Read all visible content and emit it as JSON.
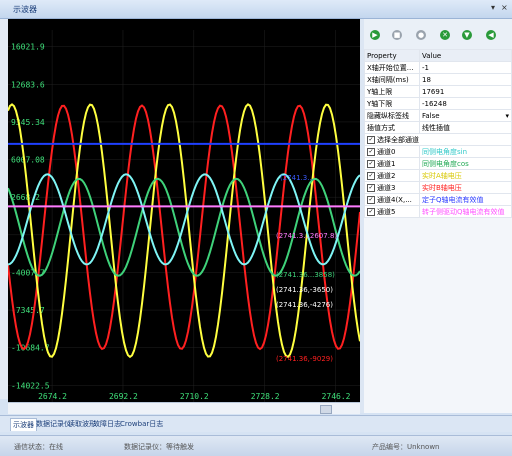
{
  "window": {
    "title": "示波器",
    "pin": "▾",
    "close": "×"
  },
  "toolbar": {
    "icons": [
      "play-icon",
      "stop-icon",
      "record-icon",
      "close-icon",
      "download-icon",
      "back-icon"
    ]
  },
  "chart_data": {
    "type": "line",
    "xlim": [
      2663.0,
      2752.4
    ],
    "ylim": [
      -15500,
      17500
    ],
    "yticks": [
      "16021.9",
      "12683.6",
      "9345.34",
      "6007.08",
      "2668.82",
      "-669.443",
      "-4007.7",
      "-7345.97",
      "-10684.2",
      "-14022.5"
    ],
    "ytick_values": [
      16021.9,
      12683.6,
      9345.34,
      6007.08,
      2668.82,
      -669.443,
      -4007.7,
      -7345.97,
      -10684.2,
      -14022.5
    ],
    "ytick_label_text": [
      "16021.9",
      "12683.6",
      "9345.34",
      "6007.08",
      "2668.2",
      "",
      "-4007.7",
      "-7345.7",
      "-10684.7",
      "-14022.5"
    ],
    "xticks": [
      "2674.2",
      "2692.2",
      "2710.2",
      "2728.2",
      "2746.2"
    ],
    "xtick_values": [
      2674.2,
      2692.2,
      2710.2,
      2728.2,
      2746.2
    ],
    "series": [
      {
        "color": "#ff2020",
        "kind": "sine",
        "amplitude": 10800,
        "offset": 0,
        "period": 20,
        "phase": 0.55
      },
      {
        "color": "#ffff40",
        "kind": "sine",
        "amplitude": 11200,
        "offset": -300,
        "period": 20,
        "phase": 0.2
      },
      {
        "color": "#3fd27a",
        "kind": "sine",
        "amplitude": 4300,
        "offset": 0,
        "period": 20,
        "phase": 0.35
      },
      {
        "color": "#7ff5f5",
        "kind": "sine",
        "amplitude": 4000,
        "offset": 700,
        "period": 20,
        "phase": 0.75
      },
      {
        "color": "#1f40ff",
        "kind": "hline",
        "value": 7400
      },
      {
        "color": "#ff7bff",
        "kind": "hline",
        "value": 1850
      }
    ],
    "annotations": [
      {
        "text": "(2741.3...",
        "color": "#3a5bff"
      },
      {
        "text": "(2741.3...2607.8)",
        "color": "#ff7bff"
      },
      {
        "text": "(2741.36...3858)",
        "color": "#3fd27a"
      },
      {
        "text": "(2741.36,-3650)",
        "color": "#ffffff"
      },
      {
        "text": "(2741.36,-4276)",
        "color": "#ffffff"
      },
      {
        "text": "(2741.36,-9029)",
        "color": "#ff2020"
      }
    ]
  },
  "properties": {
    "header": {
      "name": "Property",
      "value": "Value"
    },
    "rows": [
      {
        "name": "X轴开始位置...",
        "value": "-1"
      },
      {
        "name": "X轴间隔(ms)",
        "value": "18"
      },
      {
        "name": "Y轴上限",
        "value": "17691"
      },
      {
        "name": "Y轴下限",
        "value": "-16248"
      },
      {
        "name": "隐藏纵标签线",
        "value": "False"
      },
      {
        "name": "插值方式",
        "value": "线性插值"
      }
    ],
    "channels_all": "选择全部通道",
    "channels": [
      {
        "name": "通道0",
        "value": "同侧电角度sin",
        "color": "#33c9c9"
      },
      {
        "name": "通道1",
        "value": "同侧电角度cos",
        "color": "#22aa55"
      },
      {
        "name": "通道2",
        "value": "实时A轴电压",
        "color": "#d8c800"
      },
      {
        "name": "通道3",
        "value": "实时B轴电压",
        "color": "#ff2020"
      },
      {
        "name": "通道4(X,...",
        "value": "定子Q轴电流有效值",
        "color": "#2b3bff"
      },
      {
        "name": "通道5",
        "value": "转子侧驱动Q轴电流有效值",
        "color": "#ff4fff"
      }
    ]
  },
  "tabs": [
    "示波器",
    "数据记录仪",
    "读取波形",
    "故障日志",
    "Crowbar日志"
  ],
  "status": {
    "comm": "通信状态：在线",
    "record": "数据记录仪：等待触发",
    "product": "产品编号：Unknown"
  }
}
